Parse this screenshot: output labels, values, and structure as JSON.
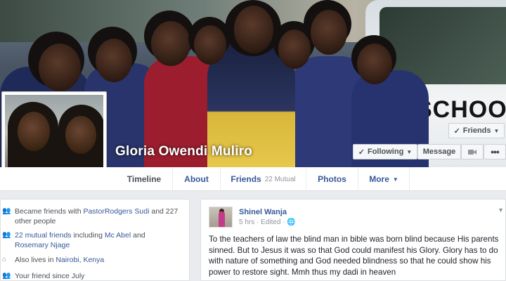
{
  "profile": {
    "name": "Gloria Owendi Muliro",
    "cover_sign_text": "SCHOOL"
  },
  "actions": {
    "friends_label": "Friends",
    "following_label": "Following",
    "message_label": "Message"
  },
  "tabs": [
    {
      "label": "Timeline",
      "active": true
    },
    {
      "label": "About"
    },
    {
      "label": "Friends",
      "sub": "22 Mutual"
    },
    {
      "label": "Photos"
    },
    {
      "label": "More"
    }
  ],
  "intro": {
    "row1": {
      "prefix": "Became friends with ",
      "link": "PastorRodgers Sudi",
      "suffix": " and 227 other people"
    },
    "row2": {
      "link1": "22 mutual friends",
      "middle": " including ",
      "link2": "Mc Abel",
      "and": " and ",
      "link3": "Rosemary Njage"
    },
    "row3": {
      "prefix": "Also lives in ",
      "link": "Nairobi, Kenya"
    },
    "row4": {
      "text": "Your friend since July"
    }
  },
  "post": {
    "author": "Shinel Wanja",
    "time": "5 hrs",
    "edited": "Edited",
    "separator": " · ",
    "text": "To the teachers of law the blind man in bible was born blind because His parents sinned. But to Jesus it was so that God could manifest his Glory. Glory has to do with nature of something and God needed blindness so that he could show his power to restore sight. Mmh thus my dadi in heaven"
  },
  "colors": {
    "link": "#365899",
    "background": "#e9ebee",
    "text": "#1d2129"
  },
  "icons": [
    "checkmark-icon",
    "caret-down-icon",
    "video-camera-icon",
    "more-dots-icon",
    "people-icon",
    "home-icon",
    "clock-icon",
    "globe-icon"
  ]
}
